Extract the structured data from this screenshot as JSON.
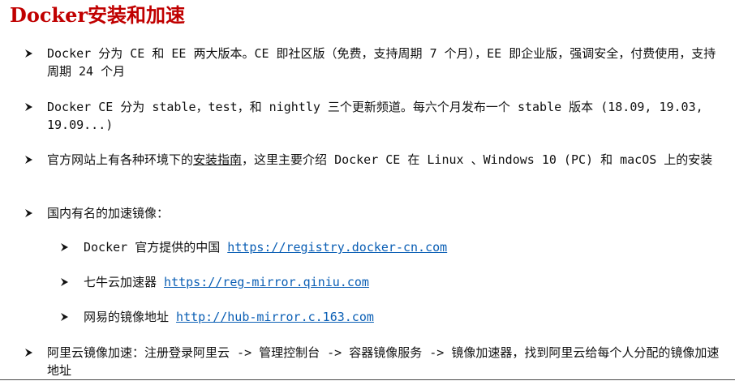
{
  "title": "Docker安装和加速",
  "items": [
    {
      "text": "Docker 分为 CE 和 EE 两大版本。CE 即社区版（免费，支持周期 7 个月），EE 即企业版，强调安全，付费使用，支持周期 24 个月"
    },
    {
      "text": "Docker CE 分为 stable，test，和 nightly 三个更新频道。每六个月发布一个 stable 版本 (18.09, 19.03, 19.09...)"
    },
    {
      "pre": "官方网站上有各种环境下的",
      "underlined": "安装指南",
      "post": "，这里主要介绍 Docker CE 在 Linux 、Windows 10 (PC) 和 macOS 上的安装"
    },
    {
      "text": "国内有名的加速镜像："
    },
    {
      "label": "Docker 官方提供的中国 ",
      "link": "https://registry.docker-cn.com"
    },
    {
      "label": "七牛云加速器 ",
      "link": "https://reg-mirror.qiniu.com"
    },
    {
      "label": "网易的镜像地址 ",
      "link": "http://hub-mirror.c.163.com"
    },
    {
      "text": "阿里云镜像加速：注册登录阿里云 -> 管理控制台 -> 容器镜像服务 -> 镜像加速器，找到阿里云给每个人分配的镜像加速地址"
    }
  ]
}
